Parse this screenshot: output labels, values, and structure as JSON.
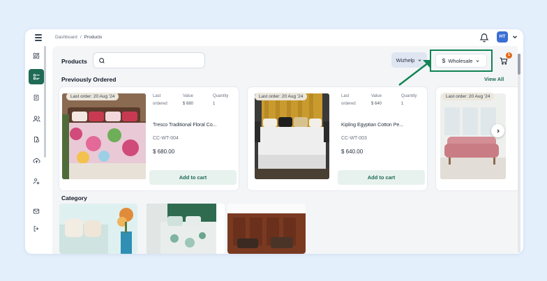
{
  "breadcrumb": {
    "parent": "Dashboard",
    "separator": "/",
    "current": "Products"
  },
  "user": {
    "initials": "HT"
  },
  "products": {
    "title": "Products",
    "search_placeholder": "",
    "wizhelp_label": "Wizhelp",
    "currency_symbol": "$",
    "pricing_label": "Wholesale",
    "cart_count": "1"
  },
  "previously_ordered": {
    "title": "Previously Ordered",
    "view_all": "View All",
    "meta_labels": {
      "last_ordered_1": "Last",
      "last_ordered_2": "ordered",
      "value": "Value",
      "quantity": "Quantity"
    },
    "items": [
      {
        "tag": "Last order: 20 Aug '24",
        "value": "$ 680",
        "quantity": "1",
        "name": "Tresco Traditional Floral Co...",
        "sku": "CC-WT-004",
        "price": "$ 680.00",
        "cta": "Add to cart"
      },
      {
        "tag": "Last order: 20 Aug '24",
        "value": "$ 640",
        "quantity": "1",
        "name": "Kipling Egyptian Cotton Pe...",
        "sku": "CC-WT-003",
        "price": "$ 640.00",
        "cta": "Add to cart"
      },
      {
        "tag": "Last order: 20 Aug '24"
      }
    ]
  },
  "category": {
    "title": "Category"
  },
  "colors": {
    "brand": "#1f6b55",
    "highlight": "#128454",
    "badge": "#e06a1b",
    "background": "#e4effc"
  },
  "icons": [
    "menu-icon",
    "bell-icon",
    "chevron-down-icon",
    "grid-icon",
    "list-icon",
    "document-icon",
    "users-icon",
    "file-dollar-icon",
    "cloud-upload-icon",
    "user-settings-icon",
    "mail-icon",
    "logout-icon",
    "search-icon",
    "dollar-icon",
    "cart-icon",
    "chevron-right-icon"
  ]
}
